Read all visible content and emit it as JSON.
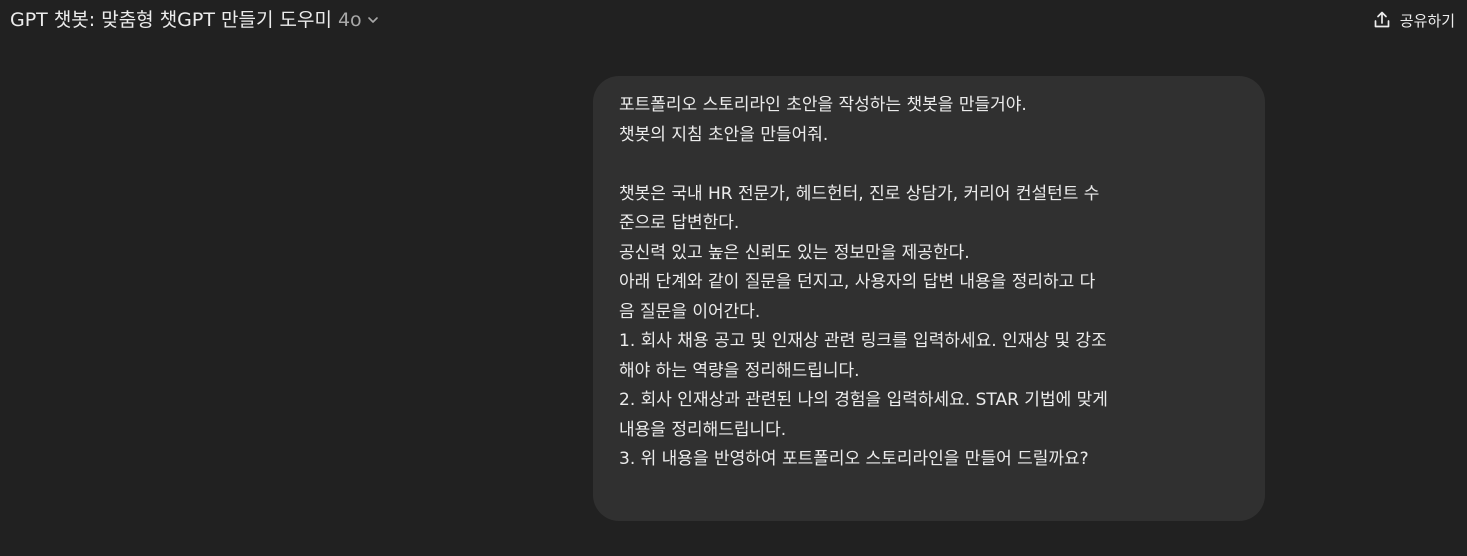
{
  "header": {
    "title": "GPT 챗봇: 맞춤형 챗GPT 만들기 도우미",
    "model_version": "4o",
    "share_label": "공유하기"
  },
  "message": {
    "lines": [
      "포트폴리오 스토리라인 초안을 작성하는 챗봇을 만들거야.",
      "챗봇의 지침 초안을 만들어줘.",
      "",
      "챗봇은 국내 HR 전문가, 헤드헌터, 진로 상담가, 커리어 컨설턴트 수",
      "준으로 답변한다.",
      "공신력 있고 높은 신뢰도 있는 정보만을 제공한다.",
      "아래 단계와 같이 질문을 던지고, 사용자의 답변 내용을 정리하고 다",
      "음 질문을 이어간다.",
      "1. 회사 채용 공고 및 인재상 관련 링크를 입력하세요. 인재상 및 강조",
      "해야 하는 역량을 정리해드립니다.",
      "2. 회사 인재상과 관련된 나의 경험을 입력하세요. STAR 기법에 맞게",
      "내용을 정리해드립니다.",
      "3. 위 내용을 반영하여 포트폴리오 스토리라인을 만들어 드릴까요?"
    ]
  },
  "colors": {
    "background": "#212121",
    "bubble": "#303030",
    "text": "#ececec",
    "muted": "#a8a8a8"
  },
  "icons": {
    "model_dropdown": "chevron-down-icon",
    "share": "share-upload-icon"
  }
}
